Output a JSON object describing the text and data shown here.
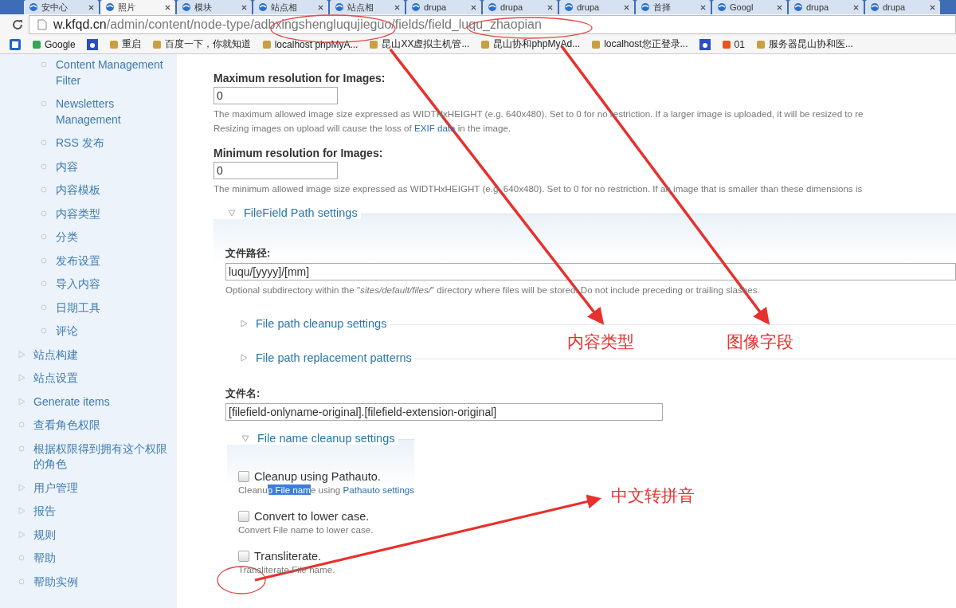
{
  "browser": {
    "tabs": [
      {
        "label": "安中心",
        "selected": false
      },
      {
        "label": "照片",
        "selected": true
      },
      {
        "label": "模块",
        "selected": false
      },
      {
        "label": "站点相",
        "selected": false
      },
      {
        "label": "站点相",
        "selected": false
      },
      {
        "label": "drupa",
        "selected": false
      },
      {
        "label": "drupa",
        "selected": false
      },
      {
        "label": "drupa",
        "selected": false
      },
      {
        "label": "首择",
        "selected": false
      },
      {
        "label": "Googl",
        "selected": false
      },
      {
        "label": "drupa",
        "selected": false
      },
      {
        "label": "drupa",
        "selected": false
      }
    ],
    "address": {
      "host": "w.kfqd.cn",
      "path": "/admin/content/node-type/adbxingshengluqujieguo/fields/field_luqu_zhaopian"
    },
    "bookmarks": [
      {
        "kind": "link",
        "label": "Google"
      },
      {
        "kind": "icon"
      },
      {
        "kind": "link",
        "label": "重启"
      },
      {
        "kind": "link",
        "label": "百度一下，你就知道"
      },
      {
        "kind": "link",
        "label": "localhost phpMyA..."
      },
      {
        "kind": "link",
        "label": "昆山XX虚拟主机管..."
      },
      {
        "kind": "link",
        "label": "昆山协和phpMyAd..."
      },
      {
        "kind": "link",
        "label": "localhost您正登录..."
      },
      {
        "kind": "icon"
      },
      {
        "kind": "link",
        "label": "01"
      },
      {
        "kind": "link",
        "label": "服务器昆山协和医..."
      }
    ]
  },
  "sidebar": {
    "nested_items": [
      {
        "label": "Content Management Filter",
        "kind": "leaf"
      },
      {
        "label": "Newsletters Management",
        "kind": "leaf"
      },
      {
        "label": "RSS 发布",
        "kind": "leaf"
      },
      {
        "label": "内容",
        "kind": "leaf"
      },
      {
        "label": "内容模板",
        "kind": "leaf"
      },
      {
        "label": "内容类型",
        "kind": "leaf"
      },
      {
        "label": "分类",
        "kind": "leaf"
      },
      {
        "label": "发布设置",
        "kind": "leaf"
      },
      {
        "label": "导入内容",
        "kind": "leaf"
      },
      {
        "label": "日期工具",
        "kind": "leaf"
      },
      {
        "label": "评论",
        "kind": "leaf"
      }
    ],
    "items": [
      {
        "label": "站点构建",
        "kind": "collapsed"
      },
      {
        "label": "站点设置",
        "kind": "collapsed"
      },
      {
        "label": "Generate items",
        "kind": "collapsed"
      },
      {
        "label": "查看角色权限",
        "kind": "leaf"
      },
      {
        "label": "根据权限得到拥有这个权限的角色",
        "kind": "leaf"
      },
      {
        "label": "用户管理",
        "kind": "collapsed"
      },
      {
        "label": "报告",
        "kind": "collapsed"
      },
      {
        "label": "规则",
        "kind": "collapsed"
      },
      {
        "label": "帮助",
        "kind": "leaf"
      },
      {
        "label": "帮助实例",
        "kind": "leaf"
      }
    ]
  },
  "form": {
    "max_resolution": {
      "label": "Maximum resolution for Images:",
      "value": "0",
      "description": "The maximum allowed image size expressed as WIDTHxHEIGHT (e.g. 640x480). Set to 0 for no restriction. If a larger image is uploaded, it will be resized to re",
      "description_2": "Resizing images on upload will cause the loss of ",
      "link": "EXIF data",
      "description_3": " in the image."
    },
    "min_resolution": {
      "label": "Minimum resolution for Images:",
      "value": "0",
      "description": "The minimum allowed image size expressed as WIDTHxHEIGHT (e.g. 640x480). Set to 0 for no restriction. If an image that is smaller than these dimensions is"
    },
    "path_fieldset": {
      "legend": "FileField Path settings",
      "expanded": true,
      "file_path": {
        "label": "文件路径:",
        "value": "luqu/[yyyy]/[mm]",
        "description": "Optional subdirectory within the \"*sites/default/files/*\" directory where files will be stored. Do not include preceding or trailing slashes."
      },
      "subsections": [
        {
          "legend": "File path cleanup settings",
          "expanded": false
        },
        {
          "legend": "File path replacement patterns",
          "expanded": false
        }
      ],
      "file_name": {
        "label": "文件名:",
        "value": "[filefield-onlyname-original].[filefield-extension-original]"
      },
      "name_cleanup": {
        "legend": "File name cleanup settings",
        "expanded": true,
        "options": [
          {
            "label": "Cleanup using Pathauto.",
            "checked": false,
            "description": "Cleanu",
            "highlighted": "p File nam",
            "description_after": "e using ",
            "link": "Pathauto settings"
          },
          {
            "label": "Convert to lower case.",
            "checked": false,
            "description": "Convert File name to lower case."
          },
          {
            "label": "Transliterate.",
            "checked": false,
            "description": "Transliterate File name."
          }
        ]
      }
    }
  },
  "annotations": [
    "内容类型",
    "图像字段",
    "中文转拼音"
  ]
}
